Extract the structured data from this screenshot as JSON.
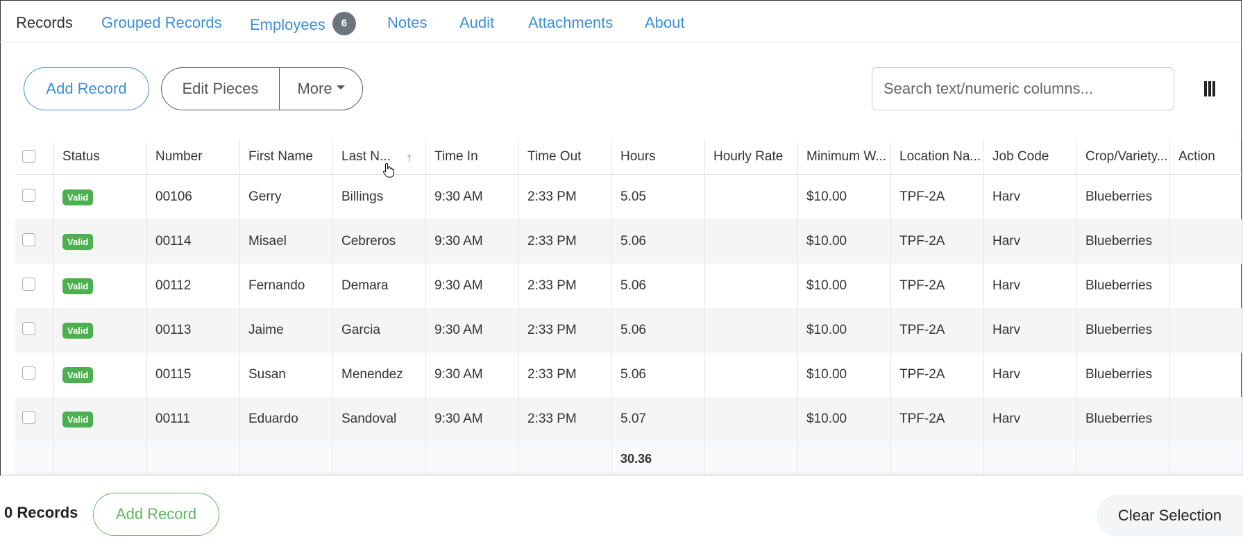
{
  "tabs": [
    {
      "label": "Records"
    },
    {
      "label": "Grouped Records"
    },
    {
      "label": "Employees",
      "badge": "6"
    },
    {
      "label": "Notes"
    },
    {
      "label": "Audit"
    },
    {
      "label": "Attachments"
    },
    {
      "label": "About"
    }
  ],
  "toolbar": {
    "add_record": "Add Record",
    "edit_pieces": "Edit Pieces",
    "more": "More",
    "search_placeholder": "Search text/numeric columns..."
  },
  "table": {
    "columns": [
      "Status",
      "Number",
      "First Name",
      "Last N...",
      "Time In",
      "Time Out",
      "Hours",
      "Hourly Rate",
      "Minimum W...",
      "Location Na...",
      "Job Code",
      "Crop/Variety...",
      "Action"
    ],
    "sorted_column": "Last N...",
    "sort_direction": "ascending",
    "rows": [
      {
        "status": "Valid",
        "number": "00106",
        "first": "Gerry",
        "last": "Billings",
        "time_in": "9:30 AM",
        "time_out": "2:33 PM",
        "hours": "5.05",
        "rate": "",
        "min_wage": "$10.00",
        "location": "TPF-2A",
        "job": "Harv",
        "crop": "Blueberries",
        "action": ""
      },
      {
        "status": "Valid",
        "number": "00114",
        "first": "Misael",
        "last": "Cebreros",
        "time_in": "9:30 AM",
        "time_out": "2:33 PM",
        "hours": "5.06",
        "rate": "",
        "min_wage": "$10.00",
        "location": "TPF-2A",
        "job": "Harv",
        "crop": "Blueberries",
        "action": ""
      },
      {
        "status": "Valid",
        "number": "00112",
        "first": "Fernando",
        "last": "Demara",
        "time_in": "9:30 AM",
        "time_out": "2:33 PM",
        "hours": "5.06",
        "rate": "",
        "min_wage": "$10.00",
        "location": "TPF-2A",
        "job": "Harv",
        "crop": "Blueberries",
        "action": ""
      },
      {
        "status": "Valid",
        "number": "00113",
        "first": "Jaime",
        "last": "Garcia",
        "time_in": "9:30 AM",
        "time_out": "2:33 PM",
        "hours": "5.06",
        "rate": "",
        "min_wage": "$10.00",
        "location": "TPF-2A",
        "job": "Harv",
        "crop": "Blueberries",
        "action": ""
      },
      {
        "status": "Valid",
        "number": "00115",
        "first": "Susan",
        "last": "Menendez",
        "time_in": "9:30 AM",
        "time_out": "2:33 PM",
        "hours": "5.06",
        "rate": "",
        "min_wage": "$10.00",
        "location": "TPF-2A",
        "job": "Harv",
        "crop": "Blueberries",
        "action": ""
      },
      {
        "status": "Valid",
        "number": "00111",
        "first": "Eduardo",
        "last": "Sandoval",
        "time_in": "9:30 AM",
        "time_out": "2:33 PM",
        "hours": "5.07",
        "rate": "",
        "min_wage": "$10.00",
        "location": "TPF-2A",
        "job": "Harv",
        "crop": "Blueberries",
        "action": ""
      }
    ],
    "totals": {
      "hours": "30.36"
    }
  },
  "footer": {
    "records_count": "0 Records",
    "add_record": "Add Record",
    "clear_selection": "Clear Selection"
  },
  "colors": {
    "accent": "#3d8fd6",
    "valid": "#4caf50",
    "success": "#5cb85c"
  }
}
